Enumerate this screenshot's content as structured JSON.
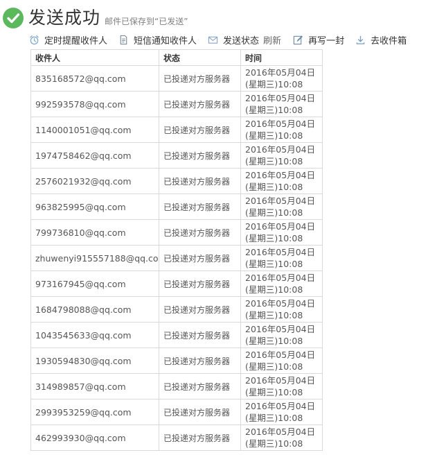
{
  "header": {
    "title": "发送成功",
    "subtitle": "邮件已保存到“已发送”",
    "check_color": "#5cb85c"
  },
  "toolbar": {
    "schedule_remind": "定时提醒收件人",
    "sms_notify": "短信通知收件人",
    "send_status": "发送状态",
    "refresh": "刷新",
    "write_another": "再写一封",
    "go_inbox": "去收件箱",
    "icons": [
      "alarm-clock-icon",
      "document-icon",
      "envelope-icon",
      "pencil-icon",
      "download-icon"
    ]
  },
  "table": {
    "headers": [
      "收件人",
      "状态",
      "时间"
    ],
    "rows": [
      {
        "recipient": "835168572@qq.com",
        "status": "已投递对方服务器",
        "time": "2016年05月04日(星期三)10:08"
      },
      {
        "recipient": "992593578@qq.com",
        "status": "已投递对方服务器",
        "time": "2016年05月04日(星期三)10:08"
      },
      {
        "recipient": "1140001051@qq.com",
        "status": "已投递对方服务器",
        "time": "2016年05月04日(星期三)10:08"
      },
      {
        "recipient": "1974758462@qq.com",
        "status": "已投递对方服务器",
        "time": "2016年05月04日(星期三)10:08"
      },
      {
        "recipient": "2576021932@qq.com",
        "status": "已投递对方服务器",
        "time": "2016年05月04日(星期三)10:08"
      },
      {
        "recipient": "963825995@qq.com",
        "status": "已投递对方服务器",
        "time": "2016年05月04日(星期三)10:08"
      },
      {
        "recipient": "799736810@qq.com",
        "status": "已投递对方服务器",
        "time": "2016年05月04日(星期三)10:08"
      },
      {
        "recipient": "zhuwenyi915557188@qq.com",
        "status": "已投递对方服务器",
        "time": "2016年05月04日(星期三)10:08"
      },
      {
        "recipient": "973167945@qq.com",
        "status": "已投递对方服务器",
        "time": "2016年05月04日(星期三)10:08"
      },
      {
        "recipient": "1684798088@qq.com",
        "status": "已投递对方服务器",
        "time": "2016年05月04日(星期三)10:08"
      },
      {
        "recipient": "1043545633@qq.com",
        "status": "已投递对方服务器",
        "time": "2016年05月04日(星期三)10:08"
      },
      {
        "recipient": "1930594830@qq.com",
        "status": "已投递对方服务器",
        "time": "2016年05月04日(星期三)10:08"
      },
      {
        "recipient": "314989857@qq.com",
        "status": "已投递对方服务器",
        "time": "2016年05月04日(星期三)10:08"
      },
      {
        "recipient": "2993953259@qq.com",
        "status": "已投递对方服务器",
        "time": "2016年05月04日(星期三)10:08"
      },
      {
        "recipient": "462993930@qq.com",
        "status": "已投递对方服务器",
        "time": "2016年05月04日(星期三)10:08"
      }
    ]
  }
}
